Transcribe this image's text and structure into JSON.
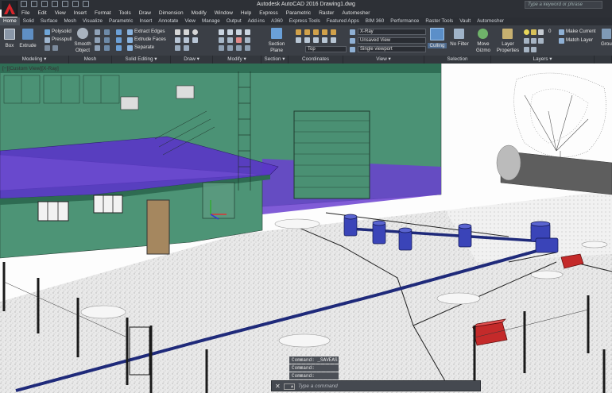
{
  "app": {
    "title": "Autodesk AutoCAD 2016   Drawing1.dwg",
    "search_placeholder": "Type a keyword or phrase"
  },
  "menu": [
    "File",
    "Edit",
    "View",
    "Insert",
    "Format",
    "Tools",
    "Draw",
    "Dimension",
    "Modify",
    "Window",
    "Help",
    "Express",
    "Parametric",
    "Raster",
    "Automesher"
  ],
  "tabs": [
    "Home",
    "Solid",
    "Surface",
    "Mesh",
    "Visualize",
    "Parametric",
    "Insert",
    "Annotate",
    "View",
    "Manage",
    "Output",
    "Add-ins",
    "A360",
    "Express Tools",
    "Featured Apps",
    "BIM 360",
    "Performance",
    "Raster Tools",
    "Vault",
    "Automesher"
  ],
  "active_tab": "Home",
  "ribbon": {
    "box": "Box",
    "extrude": "Extrude",
    "polysolid": "Polysolid",
    "presspull": "Presspull",
    "smooth_object_1": "Smooth",
    "smooth_object_2": "Object",
    "extract_edges": "Extract Edges",
    "extrude_faces": "Extrude Faces",
    "separate": "Separate",
    "section_plane_1": "Section",
    "section_plane_2": "Plane",
    "visual_style": "X-Ray",
    "named_view": "Unsaved View",
    "ucs": "Top",
    "single_viewport": "Single viewport",
    "culling": "Culling",
    "no_filter_1": "No Filter",
    "move_gizmo_1": "Move",
    "move_gizmo_2": "Gizmo",
    "layer_properties_1": "Layer",
    "layer_properties_2": "Properties",
    "layer_current": "0",
    "make_current": "Make Current",
    "match_layer": "Match Layer",
    "groups": "Grou"
  },
  "panels": [
    {
      "label": "Modeling ▾"
    },
    {
      "label": "Mesh"
    },
    {
      "label": "Solid Editing ▾"
    },
    {
      "label": "Draw ▾"
    },
    {
      "label": "Modify ▾"
    },
    {
      "label": "Section ▾"
    },
    {
      "label": "Coordinates"
    },
    {
      "label": "View ▾"
    },
    {
      "label": "Selection"
    },
    {
      "label": "Layers ▾"
    },
    {
      "label": ""
    }
  ],
  "viewport": {
    "label": "[−][Custom View][X-Ray]"
  },
  "command": {
    "history": [
      "Command: _SAVEAS",
      "Command: *Cancel*",
      "Command: *Cancel*"
    ],
    "placeholder": "Type a command"
  },
  "colors": {
    "ribbon_bg": "#3b3f46",
    "titlebar_bg": "#2d3036",
    "building_green": "#3c8a6a",
    "xray_purple": "#6a3fd0",
    "pipe_blue": "#1f2a7a",
    "box_red": "#c42a2a"
  }
}
